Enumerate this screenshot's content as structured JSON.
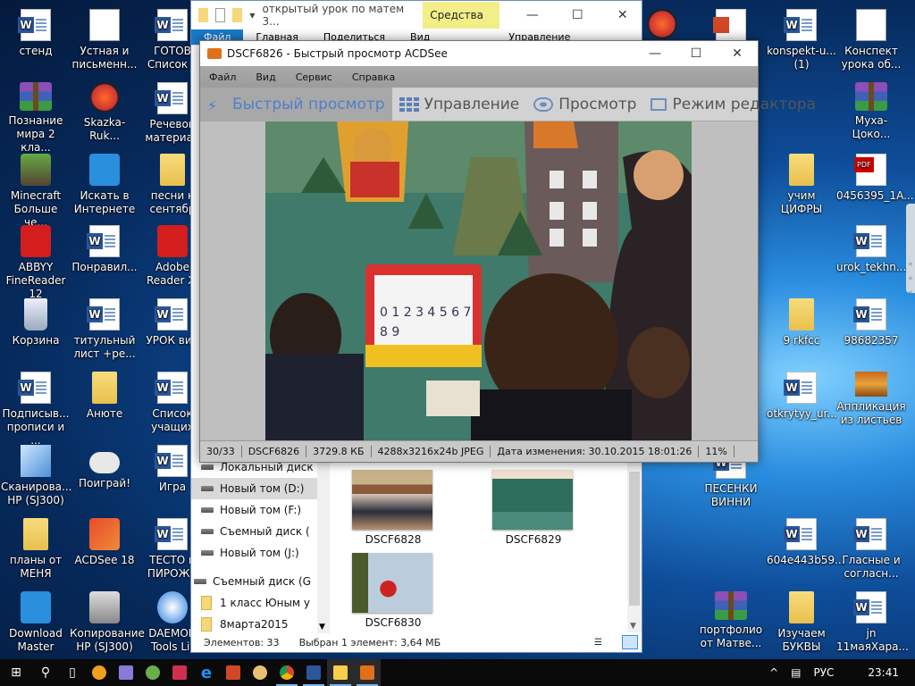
{
  "desktop": {
    "icons": [
      {
        "label": "стенд",
        "type": "word"
      },
      {
        "label": "Познание мира 2 кла...",
        "type": "rar"
      },
      {
        "label": "Minecraft Больше че...",
        "type": "app green"
      },
      {
        "label": "ABBYY FineReader 12",
        "type": "app red"
      },
      {
        "label": "Корзина",
        "type": "bin"
      },
      {
        "label": "Подписыв... прописи и ...",
        "type": "word"
      },
      {
        "label": "Сканирова... HP (SJ300)",
        "type": "scan"
      },
      {
        "label": "планы от МЕНЯ",
        "type": "folder"
      },
      {
        "label": "Download Master",
        "type": "app blue"
      },
      {
        "label": "Устная и письменн...",
        "type": "doc"
      },
      {
        "label": "Skazka-Ruk...",
        "type": "mp3"
      },
      {
        "label": "Искать в Интернете",
        "type": "app blue"
      },
      {
        "label": "Понравил...",
        "type": "word"
      },
      {
        "label": "титульный лист +ре...",
        "type": "word"
      },
      {
        "label": "Анюте",
        "type": "folder"
      },
      {
        "label": "Поиграй!",
        "type": "pad"
      },
      {
        "label": "ACDSee 18",
        "type": "app"
      },
      {
        "label": "Копирование HP (SJ300)",
        "type": "app gray"
      },
      {
        "label": "ГОТОВ Список у",
        "type": "word"
      },
      {
        "label": "Речевой материал",
        "type": "word"
      },
      {
        "label": "песни к сентябр",
        "type": "folder"
      },
      {
        "label": "Adobe Reader XI",
        "type": "app red"
      },
      {
        "label": "УРОК вин",
        "type": "word"
      },
      {
        "label": "Список учащих",
        "type": "word"
      },
      {
        "label": "Игра",
        "type": "word"
      },
      {
        "label": "ТЕСТО н ПИРОЖК",
        "type": "word"
      },
      {
        "label": "DAEMON Tools Lit",
        "type": "app daemon"
      },
      {
        "label": "",
        "type": "mp3"
      },
      {
        "label": "",
        "type": "ppt"
      },
      {
        "label": "konspekt-u... (1)",
        "type": "word"
      },
      {
        "label": "Конспект урока об...",
        "type": "doc"
      },
      {
        "label": "Муха-Цоко...",
        "type": "rar"
      },
      {
        "label": "учим ЦИФРЫ",
        "type": "folder"
      },
      {
        "label": "0456395_1A...",
        "type": "pdf"
      },
      {
        "label": "urok_tekhn...",
        "type": "word"
      },
      {
        "label": "9 rkfcc",
        "type": "folder"
      },
      {
        "label": "98682357",
        "type": "word"
      },
      {
        "label": "otkrytyy_ur...",
        "type": "word"
      },
      {
        "label": "Аппликация из листьев",
        "type": "photo"
      },
      {
        "label": "ПЕСЕНКИ ВИННИ",
        "type": "word"
      },
      {
        "label": "604e443b59...",
        "type": "word"
      },
      {
        "label": "Гласные и согласн...",
        "type": "word"
      },
      {
        "label": "портфолио от Матве...",
        "type": "rar"
      },
      {
        "label": "Изучаем БУКВЫ",
        "type": "folder"
      },
      {
        "label": "jn 11маяХара...",
        "type": "word"
      }
    ]
  },
  "explorer": {
    "title": "открытый урок по матем 3...",
    "context_tab": "Средства ...",
    "tabs": [
      "Файл",
      "Главная",
      "Поделиться",
      "Вид",
      "Управление"
    ],
    "nav": [
      {
        "label": "Локальный диск",
        "kind": "drive"
      },
      {
        "label": "Новый том (D:)",
        "kind": "drive",
        "selected": true
      },
      {
        "label": "Новый том (F:)",
        "kind": "drive"
      },
      {
        "label": "Съемный диск (",
        "kind": "drive"
      },
      {
        "label": "Новый том (J:)",
        "kind": "drive"
      },
      {
        "label": "Съемный диск (G",
        "kind": "drive"
      },
      {
        "label": "1 класс Юным у",
        "kind": "folder"
      },
      {
        "label": "8марта2015",
        "kind": "folder"
      }
    ],
    "thumbs": [
      "DSCF6828",
      "DSCF6829",
      "DSCF6830"
    ],
    "status_count": "Элементов: 33",
    "status_selected": "Выбран 1 элемент: 3,64 МБ"
  },
  "acdsee": {
    "title": "DSCF6826 - Быстрый просмотр ACDSee",
    "menu": [
      "Файл",
      "Вид",
      "Сервис",
      "Справка"
    ],
    "modes": [
      "Быстрый просмотр",
      "Управление",
      "Просмотр",
      "Режим редактора"
    ],
    "status": [
      "30/33",
      "DSCF6826",
      "3729.8 КБ",
      "4288x3216x24b JPEG",
      "Дата изменения: 30.10.2015 18:01:26",
      "11%"
    ],
    "photo_board_text": [
      "0 1 2 3 4 5 6 7",
      "8 9"
    ]
  },
  "taskbar": {
    "language": "РУС",
    "time": "23:41",
    "colors": {
      "accent": "#76b9ed"
    }
  }
}
